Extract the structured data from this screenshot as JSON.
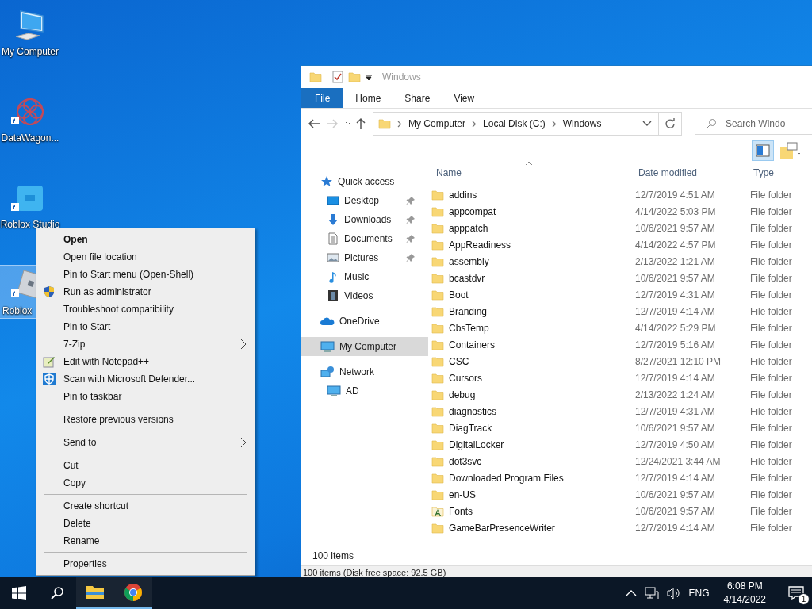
{
  "desktop_icons": [
    {
      "label": "My Computer",
      "kind": "computer",
      "shortcut": false,
      "selected": false
    },
    {
      "label": "DataWagon...",
      "kind": "datawagon",
      "shortcut": true,
      "selected": false
    },
    {
      "label": "Roblox Studio",
      "kind": "studio",
      "shortcut": true,
      "selected": false
    },
    {
      "label": "Roblox",
      "kind": "roblox",
      "shortcut": true,
      "selected": true
    }
  ],
  "explorer": {
    "title": "Windows",
    "ribbon_tabs": [
      {
        "label": "File",
        "selected": true
      },
      {
        "label": "Home",
        "selected": false
      },
      {
        "label": "Share",
        "selected": false
      },
      {
        "label": "View",
        "selected": false
      }
    ],
    "address": [
      "My Computer",
      "Local Disk (C:)",
      "Windows"
    ],
    "search": {
      "placeholder": "Search Windo"
    },
    "nav": [
      {
        "label": "Quick access",
        "kind": "star",
        "selected": false,
        "children": [
          {
            "label": "Desktop",
            "kind": "desktop",
            "pinned": true,
            "selected": false
          },
          {
            "label": "Downloads",
            "kind": "downloads",
            "pinned": true,
            "selected": false
          },
          {
            "label": "Documents",
            "kind": "documents",
            "pinned": true,
            "selected": false
          },
          {
            "label": "Pictures",
            "kind": "pictures",
            "pinned": true,
            "selected": false
          },
          {
            "label": "Music",
            "kind": "music",
            "pinned": false,
            "selected": false
          },
          {
            "label": "Videos",
            "kind": "videos",
            "pinned": false,
            "selected": false
          }
        ]
      },
      {
        "label": "OneDrive",
        "kind": "cloud",
        "selected": false
      },
      {
        "label": "My Computer",
        "kind": "computer",
        "selected": true
      },
      {
        "label": "Network",
        "kind": "network",
        "selected": false,
        "children": [
          {
            "label": "AD",
            "kind": "computer",
            "pinned": false,
            "selected": false
          }
        ]
      }
    ],
    "columns": [
      "Name",
      "Date modified",
      "Type"
    ],
    "rows": [
      {
        "name": "addins",
        "date": "12/7/2019 4:51 AM",
        "type": "File folder",
        "kind": "folder"
      },
      {
        "name": "appcompat",
        "date": "4/14/2022 5:03 PM",
        "type": "File folder",
        "kind": "folder"
      },
      {
        "name": "apppatch",
        "date": "10/6/2021 9:57 AM",
        "type": "File folder",
        "kind": "folder"
      },
      {
        "name": "AppReadiness",
        "date": "4/14/2022 4:57 PM",
        "type": "File folder",
        "kind": "folder"
      },
      {
        "name": "assembly",
        "date": "2/13/2022 1:21 AM",
        "type": "File folder",
        "kind": "folder"
      },
      {
        "name": "bcastdvr",
        "date": "10/6/2021 9:57 AM",
        "type": "File folder",
        "kind": "folder"
      },
      {
        "name": "Boot",
        "date": "12/7/2019 4:31 AM",
        "type": "File folder",
        "kind": "folder"
      },
      {
        "name": "Branding",
        "date": "12/7/2019 4:14 AM",
        "type": "File folder",
        "kind": "folder"
      },
      {
        "name": "CbsTemp",
        "date": "4/14/2022 5:29 PM",
        "type": "File folder",
        "kind": "folder"
      },
      {
        "name": "Containers",
        "date": "12/7/2019 5:16 AM",
        "type": "File folder",
        "kind": "folder"
      },
      {
        "name": "CSC",
        "date": "8/27/2021 12:10 PM",
        "type": "File folder",
        "kind": "folder"
      },
      {
        "name": "Cursors",
        "date": "12/7/2019 4:14 AM",
        "type": "File folder",
        "kind": "folder"
      },
      {
        "name": "debug",
        "date": "2/13/2022 1:24 AM",
        "type": "File folder",
        "kind": "folder"
      },
      {
        "name": "diagnostics",
        "date": "12/7/2019 4:31 AM",
        "type": "File folder",
        "kind": "folder"
      },
      {
        "name": "DiagTrack",
        "date": "10/6/2021 9:57 AM",
        "type": "File folder",
        "kind": "folder"
      },
      {
        "name": "DigitalLocker",
        "date": "12/7/2019 4:50 AM",
        "type": "File folder",
        "kind": "folder"
      },
      {
        "name": "dot3svc",
        "date": "12/24/2021 3:44 AM",
        "type": "File folder",
        "kind": "folder"
      },
      {
        "name": "Downloaded Program Files",
        "date": "12/7/2019 4:14 AM",
        "type": "File folder",
        "kind": "folder"
      },
      {
        "name": "en-US",
        "date": "10/6/2021 9:57 AM",
        "type": "File folder",
        "kind": "folder"
      },
      {
        "name": "Fonts",
        "date": "10/6/2021 9:57 AM",
        "type": "File folder",
        "kind": "fonts"
      },
      {
        "name": "GameBarPresenceWriter",
        "date": "12/7/2019 4:14 AM",
        "type": "File folder",
        "kind": "folder"
      }
    ],
    "item_count": "100 items",
    "details_bar": "100 items (Disk free space: 92.5 GB)"
  },
  "context_menu": {
    "groups": [
      [
        {
          "label": "Open",
          "kind": "plain",
          "default": true,
          "submenu": false
        },
        {
          "label": "Open file location",
          "kind": "plain",
          "default": false,
          "submenu": false
        },
        {
          "label": "Pin to Start menu (Open-Shell)",
          "kind": "plain",
          "default": false,
          "submenu": false
        },
        {
          "label": "Run as administrator",
          "kind": "shield",
          "default": false,
          "submenu": false
        },
        {
          "label": "Troubleshoot compatibility",
          "kind": "plain",
          "default": false,
          "submenu": false
        },
        {
          "label": "Pin to Start",
          "kind": "plain",
          "default": false,
          "submenu": false
        },
        {
          "label": "7-Zip",
          "kind": "plain",
          "default": false,
          "submenu": true
        },
        {
          "label": "Edit with Notepad++",
          "kind": "notepad",
          "default": false,
          "submenu": false
        },
        {
          "label": "Scan with Microsoft Defender...",
          "kind": "defender",
          "default": false,
          "submenu": false
        },
        {
          "label": "Pin to taskbar",
          "kind": "plain",
          "default": false,
          "submenu": false
        }
      ],
      [
        {
          "label": "Restore previous versions",
          "kind": "plain",
          "default": false,
          "submenu": false
        }
      ],
      [
        {
          "label": "Send to",
          "kind": "plain",
          "default": false,
          "submenu": true
        }
      ],
      [
        {
          "label": "Cut",
          "kind": "plain",
          "default": false,
          "submenu": false
        },
        {
          "label": "Copy",
          "kind": "plain",
          "default": false,
          "submenu": false
        }
      ],
      [
        {
          "label": "Create shortcut",
          "kind": "plain",
          "default": false,
          "submenu": false
        },
        {
          "label": "Delete",
          "kind": "plain",
          "default": false,
          "submenu": false
        },
        {
          "label": "Rename",
          "kind": "plain",
          "default": false,
          "submenu": false
        }
      ],
      [
        {
          "label": "Properties",
          "kind": "plain",
          "default": false,
          "submenu": false
        }
      ]
    ]
  },
  "taskbar": {
    "apps": [
      {
        "kind": "start",
        "running": false
      },
      {
        "kind": "search",
        "running": false
      },
      {
        "kind": "explorer",
        "running": true
      },
      {
        "kind": "chrome",
        "running": true
      }
    ],
    "language": "ENG",
    "time": "6:08 PM",
    "date": "4/14/2022",
    "notifications": "1"
  }
}
